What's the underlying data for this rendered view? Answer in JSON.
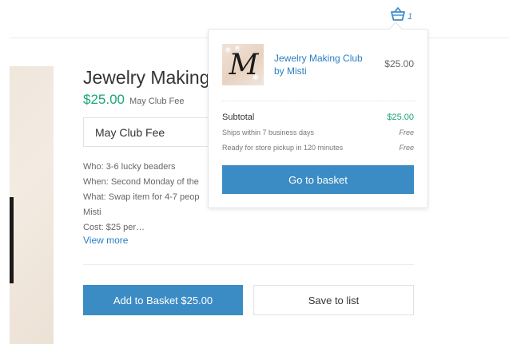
{
  "header": {
    "cart_count": "1",
    "cart_icon": "basket-icon"
  },
  "product": {
    "title": "Jewelry Making Club by Misti",
    "price": "$25.00",
    "price_label": "May Club Fee",
    "option_value": "May Club Fee",
    "description_lines": [
      "Who: 3-6 lucky beaders",
      "When: Second Monday of the",
      "What: Swap item for 4-7 peop",
      "Misti",
      "Cost: $25 per…"
    ],
    "view_more": "View more",
    "add_to_basket": "Add to Basket $25.00",
    "save_to_list": "Save to list"
  },
  "mini_cart": {
    "item": {
      "name": "Jewelry Making Club by Misti",
      "price": "$25.00",
      "thumb_letter": "M"
    },
    "subtotal_label": "Subtotal",
    "subtotal_value": "$25.00",
    "ships_label": "Ships within 7 business days",
    "ships_value": "Free",
    "pickup_label": "Ready for store pickup in 120 minutes",
    "pickup_value": "Free",
    "go_to_basket": "Go to basket"
  },
  "colors": {
    "accent_blue": "#3b8cc4",
    "link_blue": "#2b7fc2",
    "price_green": "#1aa775"
  }
}
